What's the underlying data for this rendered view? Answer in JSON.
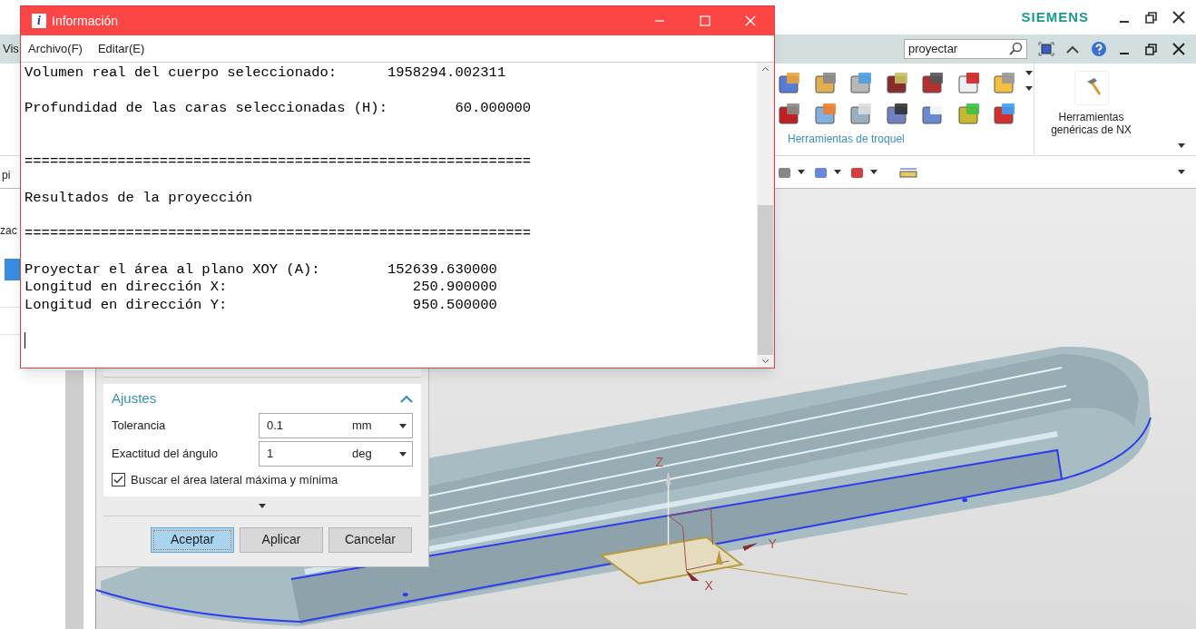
{
  "app": {
    "brand": "SIEMENS",
    "menu_partial": "Vis",
    "search": {
      "value": "proyectar"
    },
    "ribbon": {
      "group_label": "Herramientas de troquel",
      "nx_tool_label": "Herramientas genéricas de NX"
    },
    "left_panel": {
      "texts": [
        "pi",
        "zac"
      ]
    }
  },
  "info_window": {
    "icon": "i",
    "title": "Información",
    "menu": [
      "Archivo(F)",
      "Editar(E)"
    ],
    "lines": [
      {
        "kind": "line",
        "text": "Volumen real del cuerpo seleccionado:      1958294.002311"
      },
      {
        "kind": "blank"
      },
      {
        "kind": "line",
        "text": "Profundidad de las caras seleccionadas (H):        60.000000"
      },
      {
        "kind": "blank"
      },
      {
        "kind": "blank"
      },
      {
        "kind": "line",
        "text": "============================================================"
      },
      {
        "kind": "blank"
      },
      {
        "kind": "line",
        "text": "Resultados de la proyección"
      },
      {
        "kind": "blank"
      },
      {
        "kind": "line",
        "text": "============================================================"
      },
      {
        "kind": "blank"
      },
      {
        "kind": "line",
        "text": "Proyectar el área al plano XOY (A):        152639.630000"
      },
      {
        "kind": "line",
        "text": "Longitud en dirección X:                      250.900000"
      },
      {
        "kind": "line",
        "text": "Longitud en dirección Y:                      950.500000"
      }
    ]
  },
  "dialog": {
    "section": {
      "title": "Ajustes",
      "expanded": true
    },
    "fields": [
      {
        "label": "Tolerancia",
        "value": "0.1",
        "unit": "mm"
      },
      {
        "label": "Exactitud del ángulo",
        "value": "1",
        "unit": "deg"
      }
    ],
    "checkbox": {
      "label": "Buscar el área lateral máxima y mínima",
      "checked": true
    },
    "buttons": [
      {
        "label": "Aceptar",
        "default": true
      },
      {
        "label": "Aplicar",
        "default": false
      },
      {
        "label": "Cancelar",
        "default": false
      }
    ]
  },
  "viewport": {
    "axis_labels": [
      "Z",
      "Y",
      "X"
    ]
  }
}
